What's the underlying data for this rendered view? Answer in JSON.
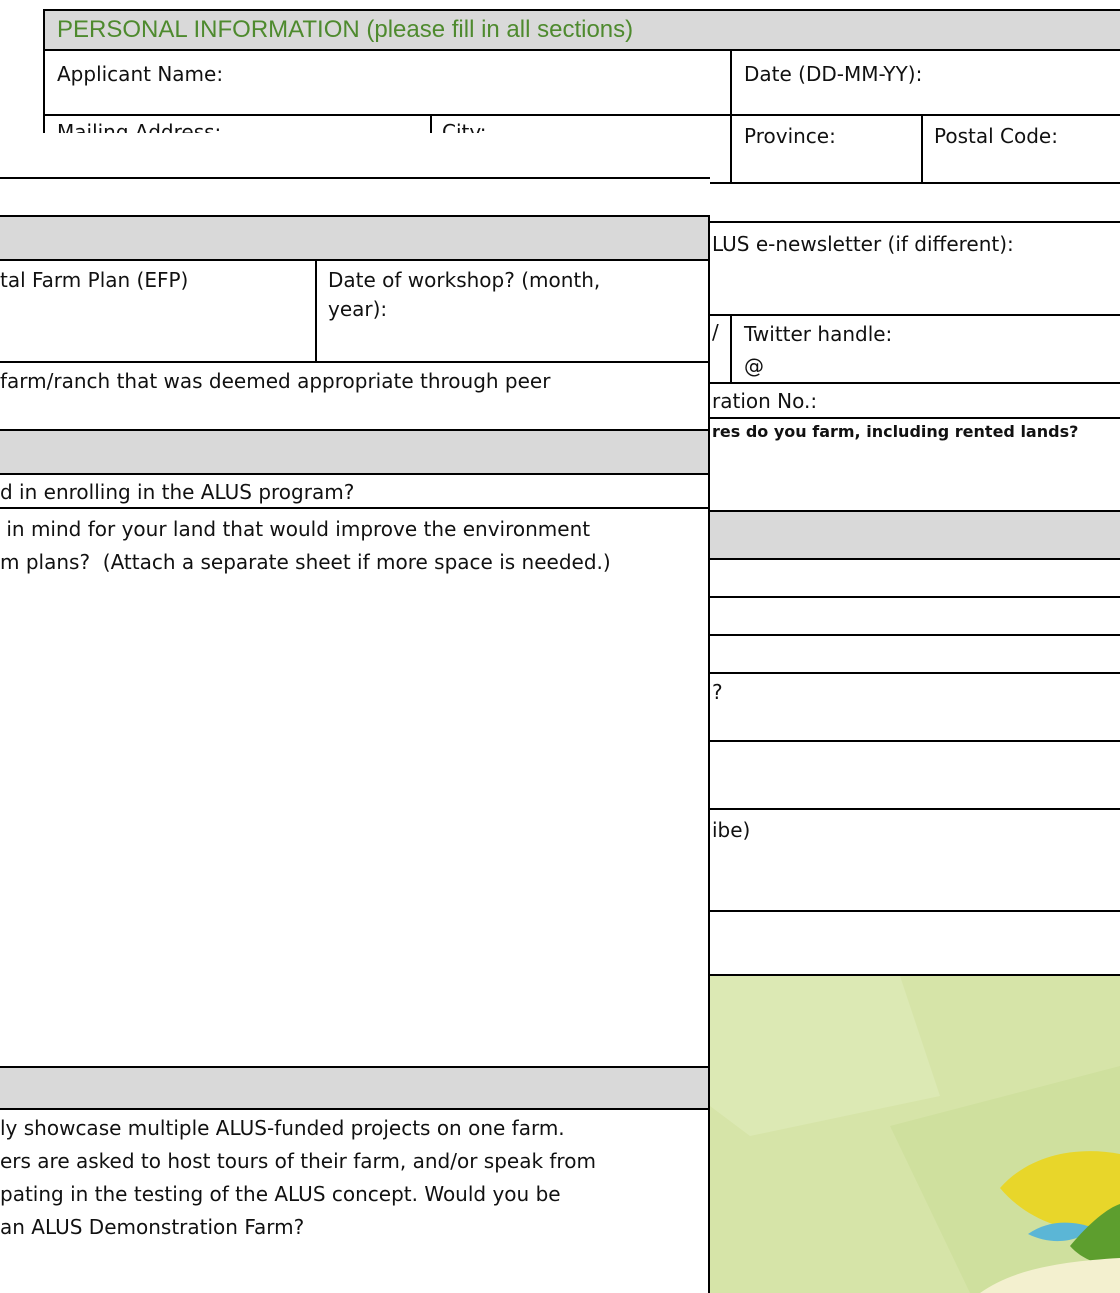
{
  "back_form": {
    "section_header": "PERSONAL INFORMATION (please fill in all sections)",
    "applicant_name_label": "Applicant Name:",
    "date_label": "Date (DD-MM-YY):",
    "mailing_address_label": "Mailing Address:",
    "city_label": "City:",
    "province_label": "Province:",
    "postal_code_label": "Postal Code:",
    "newsletter_label": "LUS e-newsletter (if different):",
    "facebook_fragment": "/",
    "twitter_label": "Twitter handle:",
    "twitter_prefix": "@",
    "registration_label": "ration No.:",
    "acres_label": "res do you farm, including rented lands?",
    "question_fragment": "?",
    "describe_fragment": "ibe)"
  },
  "front_form": {
    "efp_label": "tal Farm Plan (EFP)",
    "workshop_label_line1": "Date of workshop? (month,",
    "workshop_label_line2": "year):",
    "peer_text": "farm/ranch that was deemed appropriate through peer",
    "enrolling_text": "d in enrolling in the ALUS program?",
    "plans_line1": " in mind for your land that would improve the environment",
    "plans_line2": "m plans?  (Attach a separate sheet if more space is needed.)",
    "demo_line1": "ly showcase multiple ALUS-funded projects on one farm.",
    "demo_line2": "ers are asked to host tours of their farm, and/or speak from",
    "demo_line3": "pating in the testing of the ALUS concept. Would you be",
    "demo_line4": "an ALUS Demonstration Farm?"
  },
  "colors": {
    "header_text": "#4e8a2e",
    "header_bg": "#d9d9d9",
    "panel_green": "#d6e4a8",
    "leaf_yellow": "#e8d62a",
    "leaf_blue": "#5bb6d6",
    "leaf_green": "#5d9e2e"
  }
}
